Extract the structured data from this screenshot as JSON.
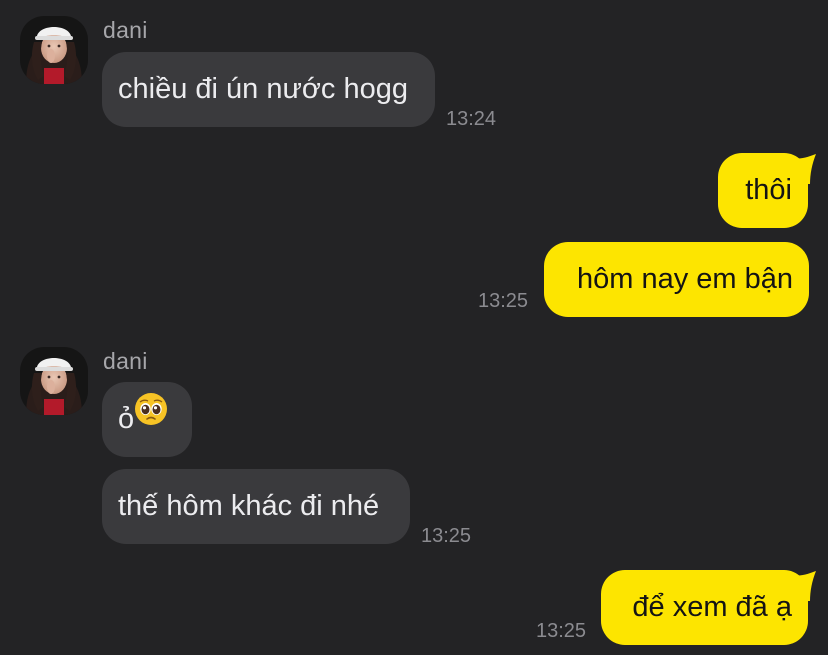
{
  "contact": {
    "name": "dani"
  },
  "messages": [
    {
      "id": "m1",
      "direction": "incoming",
      "text": "chiều đi ún nước hogg",
      "time": "13:24"
    },
    {
      "id": "m2",
      "direction": "outgoing",
      "text": "thôi"
    },
    {
      "id": "m3",
      "direction": "outgoing",
      "text": "hôm nay em bận",
      "time": "13:25"
    },
    {
      "id": "m4",
      "direction": "incoming",
      "text": "ỏ",
      "emoji": "pleading-face-icon"
    },
    {
      "id": "m5",
      "direction": "incoming",
      "text": "thế hôm khác đi nhé",
      "time": "13:25"
    },
    {
      "id": "m6",
      "direction": "outgoing",
      "text": "để xem đã ạ",
      "time": "13:25"
    }
  ],
  "colors": {
    "background": "#232325",
    "incoming_bubble": "#3a3a3d",
    "outgoing_bubble": "#fde500",
    "timestamp": "#8b8b90"
  }
}
